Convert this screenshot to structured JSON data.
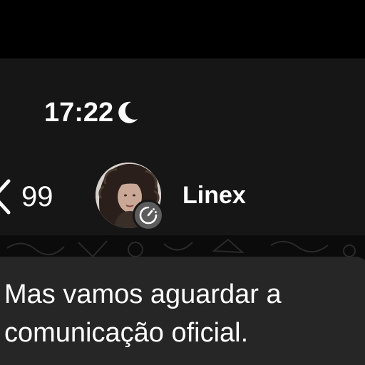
{
  "status_bar": {
    "time": "17:22",
    "focus_icon": "moon-icon"
  },
  "header": {
    "back_icon": "chevron-left-icon",
    "back_count": "99",
    "contact_name": "Linex",
    "avatar_icon": "avatar",
    "badge_icon": "disappearing-timer-icon"
  },
  "message": {
    "lines": [
      "Mas vamos aguardar a",
      "comunicação oficial."
    ]
  },
  "colors": {
    "header_bg": "#161616",
    "bubble_bg": "#262626",
    "text": "#ffffff",
    "badge_bg": "#5c5c5c"
  }
}
